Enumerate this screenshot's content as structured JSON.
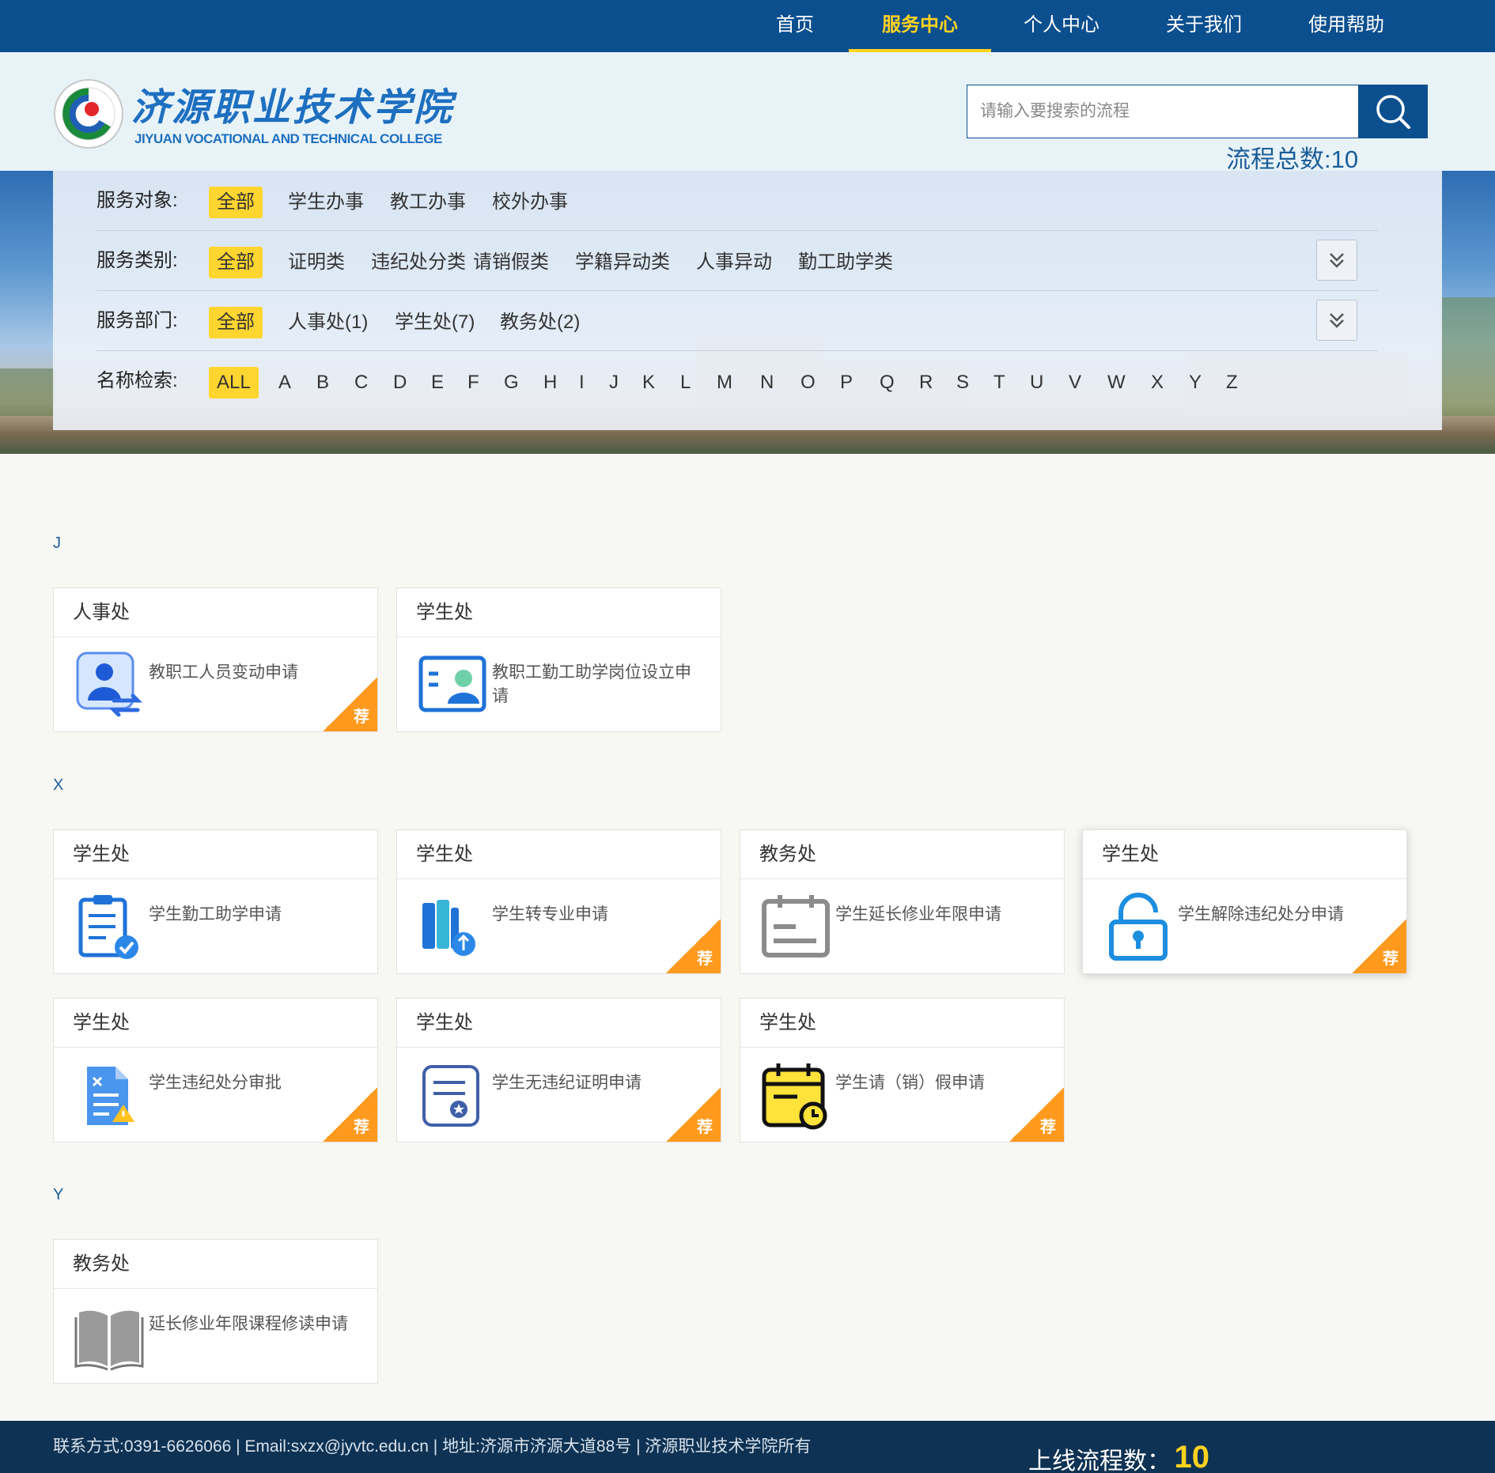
{
  "nav": {
    "items": [
      "首页",
      "服务中心",
      "个人中心",
      "关于我们",
      "使用帮助"
    ],
    "active": "服务中心"
  },
  "header": {
    "logo_cn": "济源职业技术学院",
    "logo_en": "JIYUAN VOCATIONAL AND TECHNICAL COLLEGE",
    "search_placeholder": "请输入要搜索的流程",
    "flow_total": "流程总数:10"
  },
  "filters": {
    "service_object": {
      "label": "服务对象:",
      "options": [
        "全部",
        "学生办事",
        "教工办事",
        "校外办事"
      ],
      "selected": "全部"
    },
    "service_category": {
      "label": "服务类别:",
      "options": [
        "全部",
        "证明类",
        "违纪处分类",
        "请销假类",
        "学籍异动类",
        "人事异动",
        "勤工助学类"
      ],
      "selected": "全部"
    },
    "service_department": {
      "label": "服务部门:",
      "options": [
        "全部",
        "人事处(1)",
        "学生处(7)",
        "教务处(2)"
      ],
      "selected": "全部"
    },
    "name_search": {
      "label": "名称检索:",
      "options": [
        "ALL",
        "A",
        "B",
        "C",
        "D",
        "E",
        "F",
        "G",
        "H",
        "I",
        "J",
        "K",
        "L",
        "M",
        "N",
        "O",
        "P",
        "Q",
        "R",
        "S",
        "T",
        "U",
        "V",
        "W",
        "X",
        "Y",
        "Z"
      ],
      "selected": "ALL"
    }
  },
  "groups": [
    {
      "letter": "J",
      "cards": [
        {
          "dept": "人事处",
          "title": "教职工人员变动申请",
          "icon": "user-transfer-icon",
          "recommended": true,
          "rec_label": "荐"
        },
        {
          "dept": "学生处",
          "title": "教职工勤工助学岗位设立申请",
          "icon": "id-card-icon",
          "recommended": false
        }
      ]
    },
    {
      "letter": "X",
      "cards": [
        {
          "dept": "学生处",
          "title": "学生勤工助学申请",
          "icon": "clipboard-check-icon",
          "recommended": false
        },
        {
          "dept": "学生处",
          "title": "学生转专业申请",
          "icon": "books-switch-icon",
          "recommended": true,
          "rec_label": "荐"
        },
        {
          "dept": "教务处",
          "title": "学生延长修业年限申请",
          "icon": "calendar-form-icon",
          "recommended": false
        },
        {
          "dept": "学生处",
          "title": "学生解除违纪处分申请",
          "icon": "unlock-icon",
          "recommended": true,
          "rec_label": "荐"
        },
        {
          "dept": "学生处",
          "title": "学生违纪处分审批",
          "icon": "document-warning-icon",
          "recommended": true,
          "rec_label": "荐"
        },
        {
          "dept": "学生处",
          "title": "学生无违纪证明申请",
          "icon": "certificate-icon",
          "recommended": true,
          "rec_label": "荐"
        },
        {
          "dept": "学生处",
          "title": "学生请（销）假申请",
          "icon": "calendar-clock-icon",
          "recommended": true,
          "rec_label": "荐"
        }
      ]
    },
    {
      "letter": "Y",
      "cards": [
        {
          "dept": "教务处",
          "title": "延长修业年限课程修读申请",
          "icon": "open-book-icon",
          "recommended": false
        }
      ]
    }
  ],
  "footer": {
    "info": "联系方式:0391-6626066 | Email:sxzx@jyvtc.edu.cn | 地址:济源市济源大道88号 | 济源职业技术学院所有",
    "total_label": "上线流程数：",
    "total_value": "10"
  },
  "colors": {
    "primary": "#0b4f8f",
    "accent": "#ffd21f",
    "recommend": "#ff9a1f"
  }
}
